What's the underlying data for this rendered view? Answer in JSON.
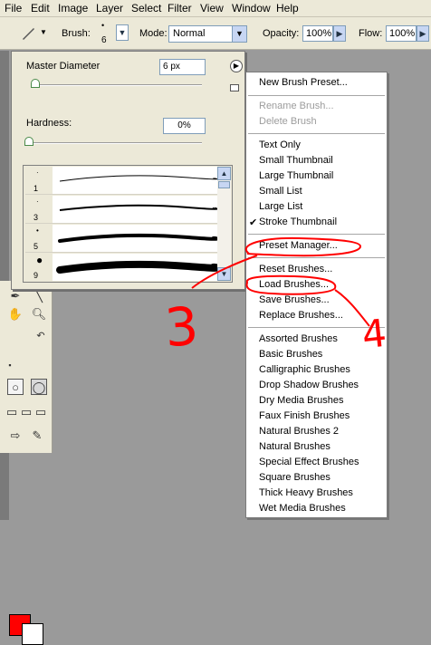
{
  "menubar": {
    "items": [
      "File",
      "Edit",
      "Image",
      "Layer",
      "Select",
      "Filter",
      "View",
      "Window",
      "Help"
    ]
  },
  "options_bar": {
    "brush_label": "Brush:",
    "brush_size": "6",
    "mode_label": "Mode:",
    "mode_value": "Normal",
    "opacity_label": "Opacity:",
    "opacity_value": "100%",
    "flow_label": "Flow:",
    "flow_value": "100%"
  },
  "brush_panel": {
    "master_diameter_label": "Master Diameter",
    "master_diameter_value": "6 px",
    "hardness_label": "Hardness:",
    "hardness_value": "0%",
    "master_diameter_level": 0.02,
    "hardness_level": 0.0,
    "brushes": [
      {
        "size": "1"
      },
      {
        "size": "3"
      },
      {
        "size": "5"
      },
      {
        "size": "9"
      }
    ]
  },
  "flyout_menu": {
    "new_brush_preset": "New Brush Preset...",
    "rename_brush": "Rename Brush...",
    "delete_brush": "Delete Brush",
    "text_only": "Text Only",
    "small_thumbnail": "Small Thumbnail",
    "large_thumbnail": "Large Thumbnail",
    "small_list": "Small List",
    "large_list": "Large List",
    "stroke_thumbnail": "Stroke Thumbnail",
    "preset_manager": "Preset Manager...",
    "reset_brushes": "Reset Brushes...",
    "load_brushes": "Load Brushes...",
    "save_brushes": "Save Brushes...",
    "replace_brushes": "Replace Brushes...",
    "libraries": [
      "Assorted Brushes",
      "Basic Brushes",
      "Calligraphic Brushes",
      "Drop Shadow Brushes",
      "Dry Media Brushes",
      "Faux Finish Brushes",
      "Natural Brushes 2",
      "Natural Brushes",
      "Special Effect Brushes",
      "Square Brushes",
      "Thick Heavy Brushes",
      "Wet Media Brushes"
    ]
  },
  "annotations": {
    "step_3": "3",
    "step_4": "4"
  },
  "colors": {
    "foreground": "#ff0000",
    "background": "#ffffff",
    "annotation": "#ff0000"
  }
}
